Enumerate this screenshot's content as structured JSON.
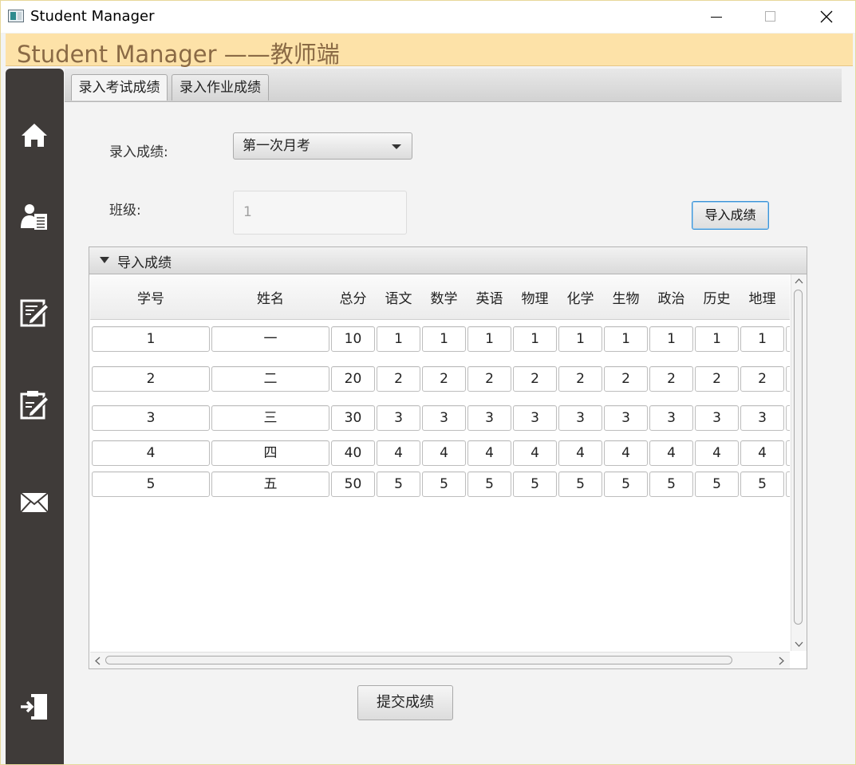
{
  "window": {
    "title": "Student Manager"
  },
  "header": {
    "title": "Student Manager ——教师端"
  },
  "sidebar": {
    "items": [
      {
        "icon": "home-icon"
      },
      {
        "icon": "student-list-icon"
      },
      {
        "icon": "edit-document-icon"
      },
      {
        "icon": "clipboard-edit-icon"
      },
      {
        "icon": "mail-icon"
      },
      {
        "icon": "logout-icon"
      }
    ]
  },
  "tabs": [
    {
      "label": "录入考试成绩",
      "active": true
    },
    {
      "label": "录入作业成绩",
      "active": false
    }
  ],
  "form": {
    "score_label": "录入成绩:",
    "exam_selected": "第一次月考",
    "class_label": "班级:",
    "class_placeholder": "1",
    "import_button": "导入成绩"
  },
  "pane": {
    "title": "导入成绩"
  },
  "table": {
    "columns": [
      "学号",
      "姓名",
      "总分",
      "语文",
      "数学",
      "英语",
      "物理",
      "化学",
      "生物",
      "政治",
      "历史",
      "地理"
    ],
    "rows": [
      [
        "1",
        "一",
        "10",
        "1",
        "1",
        "1",
        "1",
        "1",
        "1",
        "1",
        "1",
        "1"
      ],
      [
        "2",
        "二",
        "20",
        "2",
        "2",
        "2",
        "2",
        "2",
        "2",
        "2",
        "2",
        "2"
      ],
      [
        "3",
        "三",
        "30",
        "3",
        "3",
        "3",
        "3",
        "3",
        "3",
        "3",
        "3",
        "3"
      ],
      [
        "4",
        "四",
        "40",
        "4",
        "4",
        "4",
        "4",
        "4",
        "4",
        "4",
        "4",
        "4"
      ],
      [
        "5",
        "五",
        "50",
        "5",
        "5",
        "5",
        "5",
        "5",
        "5",
        "5",
        "5",
        "5"
      ]
    ]
  },
  "submit_button": "提交成绩",
  "colors": {
    "header_bg": "#fde2a8",
    "header_text": "#8a6a45",
    "sidebar_bg": "#3f3b39",
    "focus_border": "#3c93d6"
  }
}
